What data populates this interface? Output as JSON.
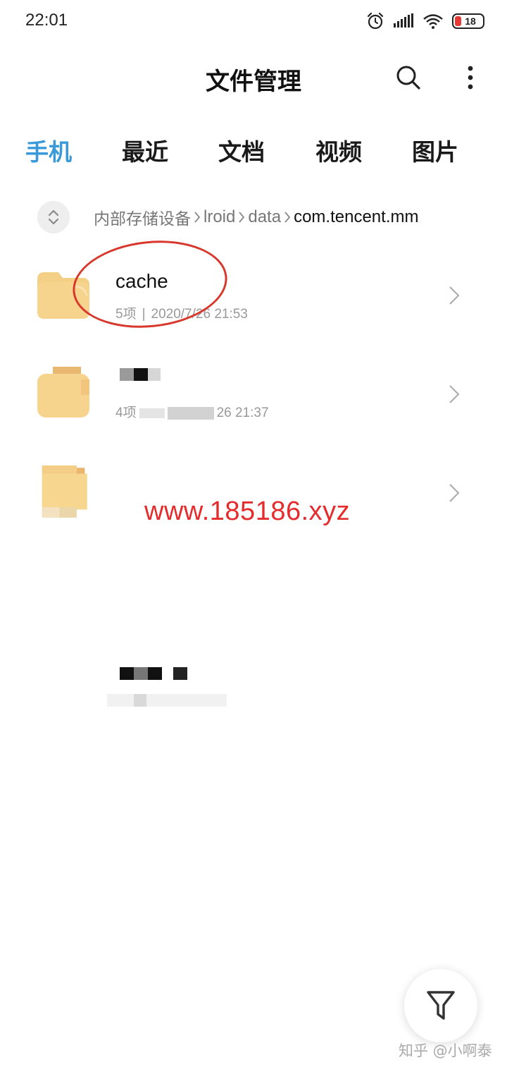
{
  "status_bar": {
    "time": "22:01",
    "battery_level": "18",
    "battery_color": "#e53935"
  },
  "header": {
    "title": "文件管理",
    "search_icon": "search-icon",
    "more_icon": "more-vertical-icon"
  },
  "tabs": [
    {
      "label": "手机",
      "active": true
    },
    {
      "label": "最近",
      "active": false
    },
    {
      "label": "文档",
      "active": false
    },
    {
      "label": "视频",
      "active": false
    },
    {
      "label": "图片",
      "active": false
    }
  ],
  "accent_color": "#3a9ad9",
  "breadcrumb": {
    "toggle_icon": "expand-collapse-icon",
    "items": [
      "内部存储设备",
      "lroid",
      "data",
      "com.tencent.mm"
    ]
  },
  "files": [
    {
      "name": "cache",
      "count": "5项",
      "date": "2020/7/26 21:53"
    },
    {
      "name": "",
      "count": "4项",
      "date": "26 21:37"
    },
    {
      "name": "",
      "count": "",
      "date": ""
    }
  ],
  "folder_color": "#f6d28a",
  "annotation_color": "#d8382c",
  "watermark_url": "www.185186.xyz",
  "fab_icon": "filter-icon",
  "watermark_credit": "知乎 @小啊泰"
}
